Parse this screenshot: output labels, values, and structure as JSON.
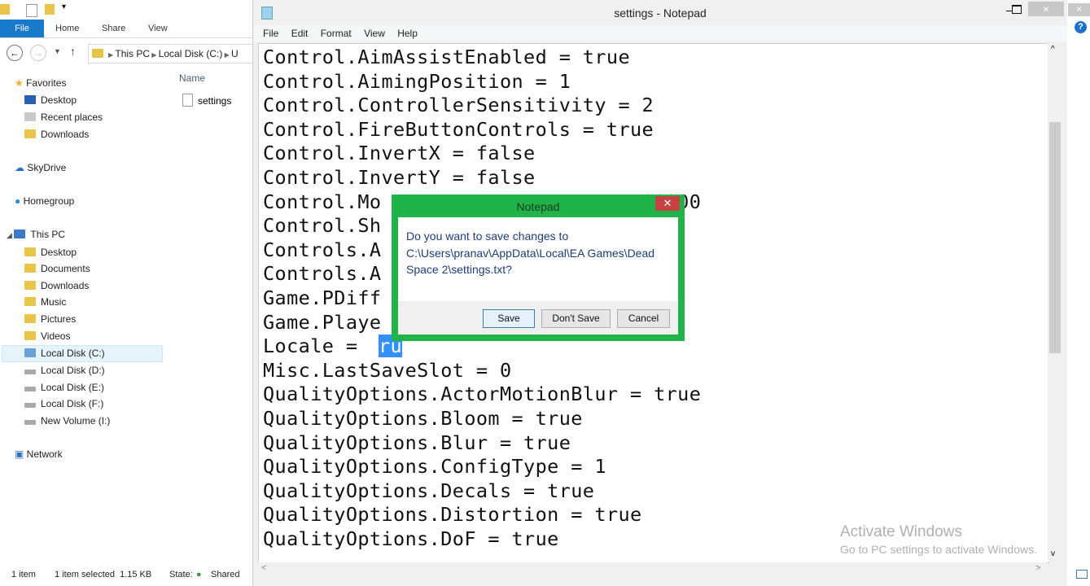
{
  "explorer": {
    "ribbon_tabs": [
      "File",
      "Home",
      "Share",
      "View"
    ],
    "breadcrumb": [
      "This PC",
      "Local Disk (C:)",
      "U"
    ],
    "column_header": "Name",
    "file": "settings",
    "nav": {
      "favorites": "Favorites",
      "favorites_items": [
        "Desktop",
        "Recent places",
        "Downloads"
      ],
      "skydrive": "SkyDrive",
      "homegroup": "Homegroup",
      "thispc": "This PC",
      "thispc_items": [
        "Desktop",
        "Documents",
        "Downloads",
        "Music",
        "Pictures",
        "Videos",
        "Local Disk (C:)",
        "Local Disk (D:)",
        "Local Disk (E:)",
        "Local Disk (F:)",
        "New Volume (I:)"
      ],
      "network": "Network"
    },
    "status": {
      "items": "1 item",
      "selected": "1 item selected  1.15 KB",
      "state_label": "State:",
      "state": "Shared"
    }
  },
  "notepad": {
    "title": "settings - Notepad",
    "menu": [
      "File",
      "Edit",
      "Format",
      "View",
      "Help"
    ],
    "lines": [
      "Control.AimAssistEnabled = true",
      "Control.AimingPosition = 1",
      "Control.ControllerSensitivity = 2",
      "Control.FireButtonControls = true",
      "Control.InvertX = false",
      "Control.InvertY = false",
      "Control.Mo                      00000",
      "Control.Sh",
      "Controls.A",
      "Controls.A",
      "Game.PDiff",
      "Game.Playe",
      "Locale = ",
      "Misc.LastSaveSlot = 0",
      "QualityOptions.ActorMotionBlur = true",
      "QualityOptions.Bloom = true",
      "QualityOptions.Blur = true",
      "QualityOptions.ConfigType = 1",
      "QualityOptions.Decals = true",
      "QualityOptions.Distortion = true",
      "QualityOptions.DoF = true"
    ],
    "selected_text": "ru"
  },
  "dialog": {
    "title": "Notepad",
    "message": "Do you want to save changes to C:\\Users\\pranav\\AppData\\Local\\EA Games\\Dead Space 2\\settings.txt?",
    "buttons": {
      "save": "Save",
      "dont_save": "Don't Save",
      "cancel": "Cancel"
    },
    "accent": "#1fb34a"
  },
  "watermark": {
    "title": "Activate Windows",
    "subtitle": "Go to PC settings to activate Windows."
  }
}
